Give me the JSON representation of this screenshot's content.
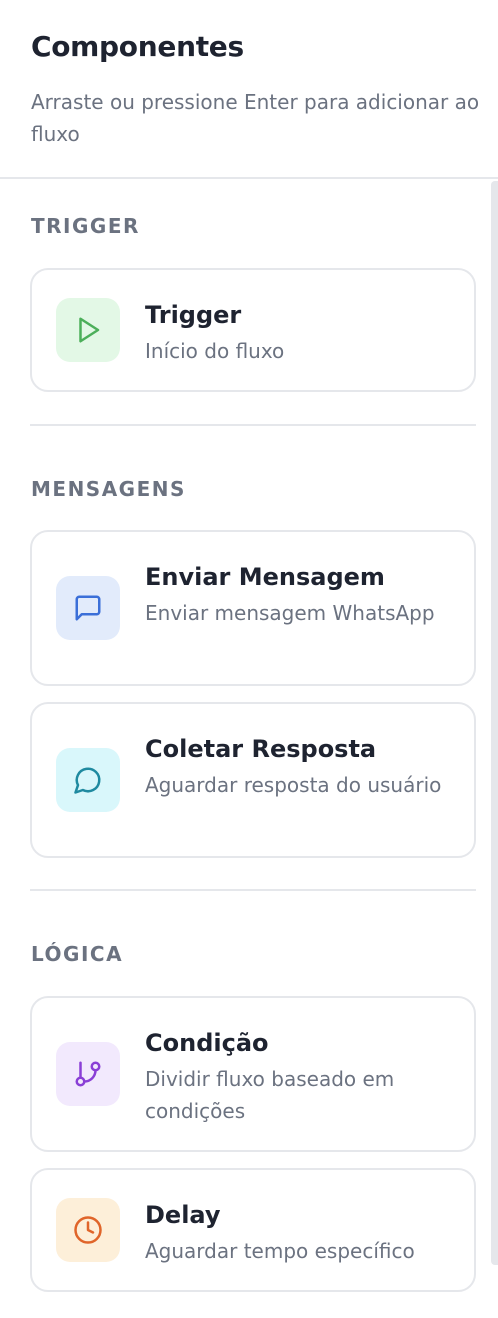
{
  "header": {
    "title": "Componentes",
    "subtitle": "Arraste ou pressione Enter para adicionar ao fluxo"
  },
  "sections": [
    {
      "title": "TRIGGER",
      "items": [
        {
          "label": "Trigger",
          "description": "Início do fluxo",
          "icon": "play-icon",
          "icon_color": "#4caf5a",
          "icon_bg": "#e3f8e6"
        }
      ]
    },
    {
      "title": "MENSAGENS",
      "items": [
        {
          "label": "Enviar Mensagem",
          "description": "Enviar mensagem WhatsApp",
          "icon": "message-square-icon",
          "icon_color": "#3b6fd8",
          "icon_bg": "#e2ebfb"
        },
        {
          "label": "Coletar Resposta",
          "description": "Aguardar resposta do usuário",
          "icon": "message-circle-icon",
          "icon_color": "#1f8aa0",
          "icon_bg": "#d9f7fb"
        }
      ]
    },
    {
      "title": "LÓGICA",
      "items": [
        {
          "label": "Condição",
          "description": "Dividir fluxo baseado em condições",
          "icon": "git-branch-icon",
          "icon_color": "#8a3fd6",
          "icon_bg": "#f2e9fd"
        },
        {
          "label": "Delay",
          "description": "Aguardar tempo específico",
          "icon": "clock-icon",
          "icon_color": "#e0652a",
          "icon_bg": "#fdefd9"
        }
      ]
    }
  ]
}
